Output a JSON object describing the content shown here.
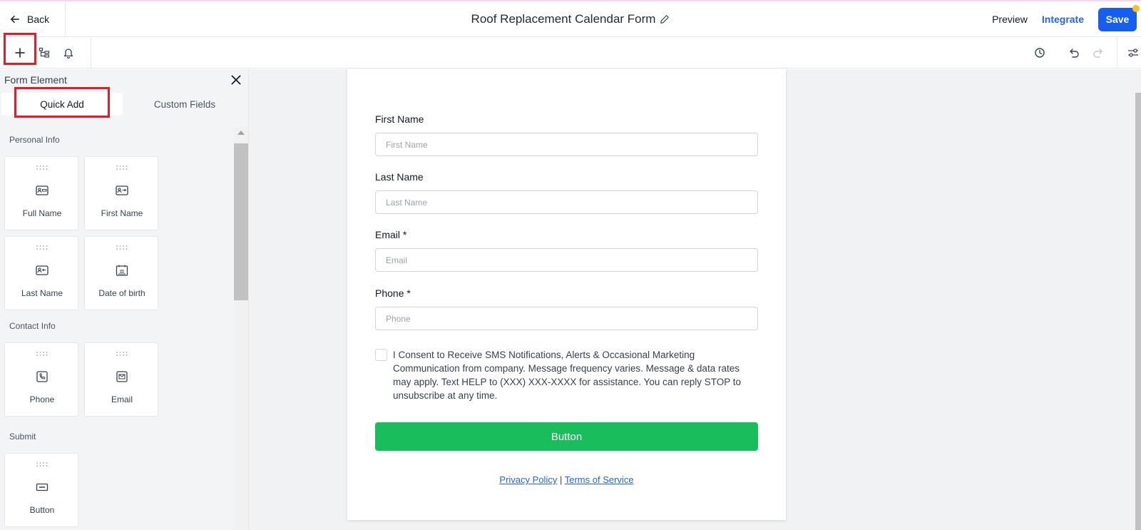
{
  "header": {
    "back_label": "Back",
    "title": "Roof Replacement Calendar Form",
    "preview_label": "Preview",
    "integrate_label": "Integrate",
    "save_label": "Save"
  },
  "sidebar": {
    "heading": "Form Element",
    "tabs": [
      {
        "label": "Quick Add"
      },
      {
        "label": "Custom Fields"
      }
    ],
    "sections": [
      {
        "title": "Personal Info",
        "items": [
          {
            "label": "Full Name",
            "icon": "id-card-icon"
          },
          {
            "label": "First Name",
            "icon": "id-card-icon"
          },
          {
            "label": "Last Name",
            "icon": "id-card-icon"
          },
          {
            "label": "Date of birth",
            "icon": "calendar-icon"
          }
        ]
      },
      {
        "title": "Contact Info",
        "items": [
          {
            "label": "Phone",
            "icon": "phone-icon"
          },
          {
            "label": "Email",
            "icon": "mail-icon"
          }
        ]
      },
      {
        "title": "Submit",
        "items": [
          {
            "label": "Button",
            "icon": "button-icon"
          }
        ]
      }
    ]
  },
  "form": {
    "fields": [
      {
        "label": "First Name",
        "placeholder": "First Name"
      },
      {
        "label": "Last Name",
        "placeholder": "Last Name"
      },
      {
        "label": "Email *",
        "placeholder": "Email"
      },
      {
        "label": "Phone *",
        "placeholder": "Phone"
      }
    ],
    "consent": "I Consent to Receive SMS Notifications, Alerts & Occasional Marketing Communication from company. Message frequency varies. Message & data rates may apply. Text HELP to (XXX) XXX-XXXX for assistance. You can reply STOP to unsubscribe at any time.",
    "button_label": "Button",
    "privacy_label": "Privacy Policy",
    "separator": "|",
    "terms_label": "Terms of Service"
  },
  "colors": {
    "save_bg": "#155eef",
    "integrate": "#2563eb",
    "submit_green": "#19bd5c",
    "highlight_red": "#e11d28"
  }
}
